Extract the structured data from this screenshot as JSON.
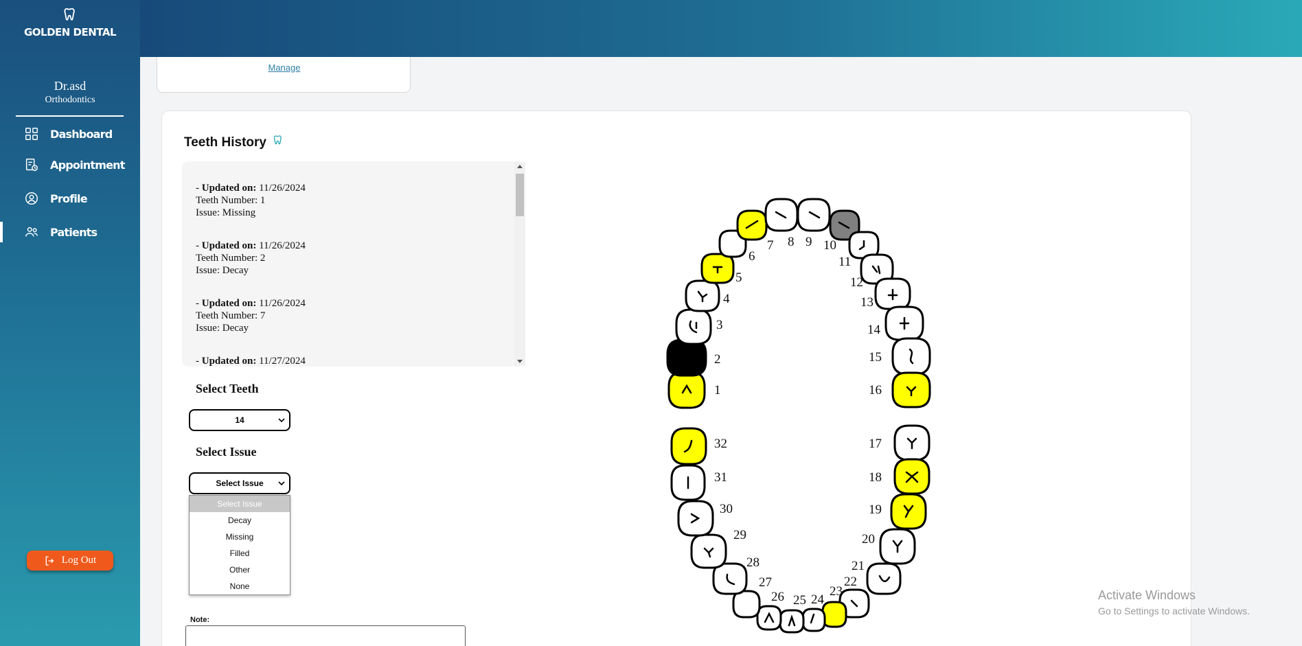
{
  "app": {
    "brand": "GOLDEN DENTAL"
  },
  "doctor": {
    "name": "Dr.asd",
    "specialty": "Orthodontics"
  },
  "nav": [
    {
      "label": "Dashboard",
      "icon": "grid-icon"
    },
    {
      "label": "Appointment",
      "icon": "calendar-clipboard-icon"
    },
    {
      "label": "Profile",
      "icon": "user-circle-icon"
    },
    {
      "label": "Patients",
      "icon": "users-icon"
    }
  ],
  "logout_label": "Log Out",
  "top_card": {
    "link": "Manage"
  },
  "history": {
    "title": "Teeth History",
    "entries": [
      {
        "prefix": "- ",
        "updated_label": "Updated on:",
        "date": "11/26/2024",
        "teeth_line": "Teeth Number: 1",
        "issue_line": "Issue: Missing"
      },
      {
        "prefix": "- ",
        "updated_label": "Updated on:",
        "date": "11/26/2024",
        "teeth_line": "Teeth Number: 2",
        "issue_line": "Issue: Decay"
      },
      {
        "prefix": "- ",
        "updated_label": "Updated on:",
        "date": "11/26/2024",
        "teeth_line": "Teeth Number: 7",
        "issue_line": "Issue: Decay"
      },
      {
        "prefix": "- ",
        "updated_label": "Updated on:",
        "date": "11/27/2024"
      }
    ]
  },
  "form": {
    "select_teeth_label": "Select Teeth",
    "teeth_value": "14",
    "select_issue_label": "Select Issue",
    "issue_value": "Select Issue",
    "issue_options": [
      "Select Issue",
      "Decay",
      "Missing",
      "Filled",
      "Other",
      "None"
    ],
    "note_label": "Note:"
  },
  "teeth_chart": {
    "numbers": [
      "1",
      "2",
      "3",
      "4",
      "5",
      "6",
      "7",
      "8",
      "9",
      "10",
      "11",
      "12",
      "13",
      "14",
      "15",
      "16",
      "17",
      "18",
      "19",
      "20",
      "21",
      "22",
      "23",
      "24",
      "25",
      "26",
      "27",
      "28",
      "29",
      "30",
      "31",
      "32"
    ],
    "colors": {
      "decay": "#ffff00",
      "missing": "#000000",
      "filled": "#808080",
      "healthy": "#ffffff"
    },
    "status": {
      "1": "decay",
      "2": "missing",
      "3": "healthy",
      "4": "healthy",
      "5": "decay",
      "6": "healthy",
      "7": "decay",
      "8": "healthy",
      "9": "healthy",
      "10": "filled",
      "11": "healthy",
      "12": "healthy",
      "13": "healthy",
      "14": "healthy",
      "15": "healthy",
      "16": "decay",
      "17": "healthy",
      "18": "decay",
      "19": "decay",
      "20": "healthy",
      "21": "healthy",
      "22": "healthy",
      "23": "decay",
      "24": "healthy",
      "25": "healthy",
      "26": "healthy",
      "27": "healthy",
      "28": "healthy",
      "29": "healthy",
      "30": "healthy",
      "31": "healthy",
      "32": "decay"
    }
  },
  "watermark": {
    "line1": "Activate Windows",
    "line2": "Go to Settings to activate Windows."
  }
}
